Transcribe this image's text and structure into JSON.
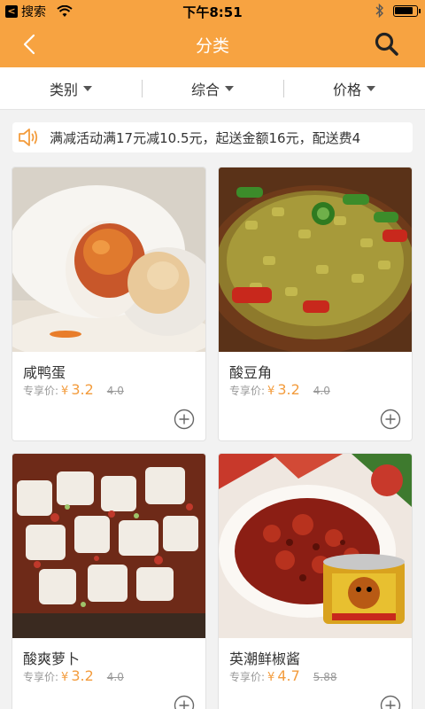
{
  "status_bar": {
    "back_app": "搜索",
    "time": "下午8:51",
    "battery_level": 0.85
  },
  "nav": {
    "title": "分类"
  },
  "filters": [
    {
      "label": "类别"
    },
    {
      "label": "综合"
    },
    {
      "label": "价格"
    }
  ],
  "notice": {
    "text": "满减活动满17元减10.5元，起送金额16元，配送费4"
  },
  "products": [
    {
      "name": "咸鸭蛋",
      "price_label": "专享价:",
      "currency": "¥",
      "price": "3.2",
      "original_price": "4.0"
    },
    {
      "name": "酸豆角",
      "price_label": "专享价:",
      "currency": "¥",
      "price": "3.2",
      "original_price": "4.0"
    },
    {
      "name": "酸爽萝卜",
      "price_label": "专享价:",
      "currency": "¥",
      "price": "3.2",
      "original_price": "4.0"
    },
    {
      "name": "英潮鲜椒酱",
      "price_label": "专享价:",
      "currency": "¥",
      "price": "4.7",
      "original_price": "5.88"
    }
  ],
  "colors": {
    "brand": "#f7a341",
    "price": "#f39c3d"
  }
}
